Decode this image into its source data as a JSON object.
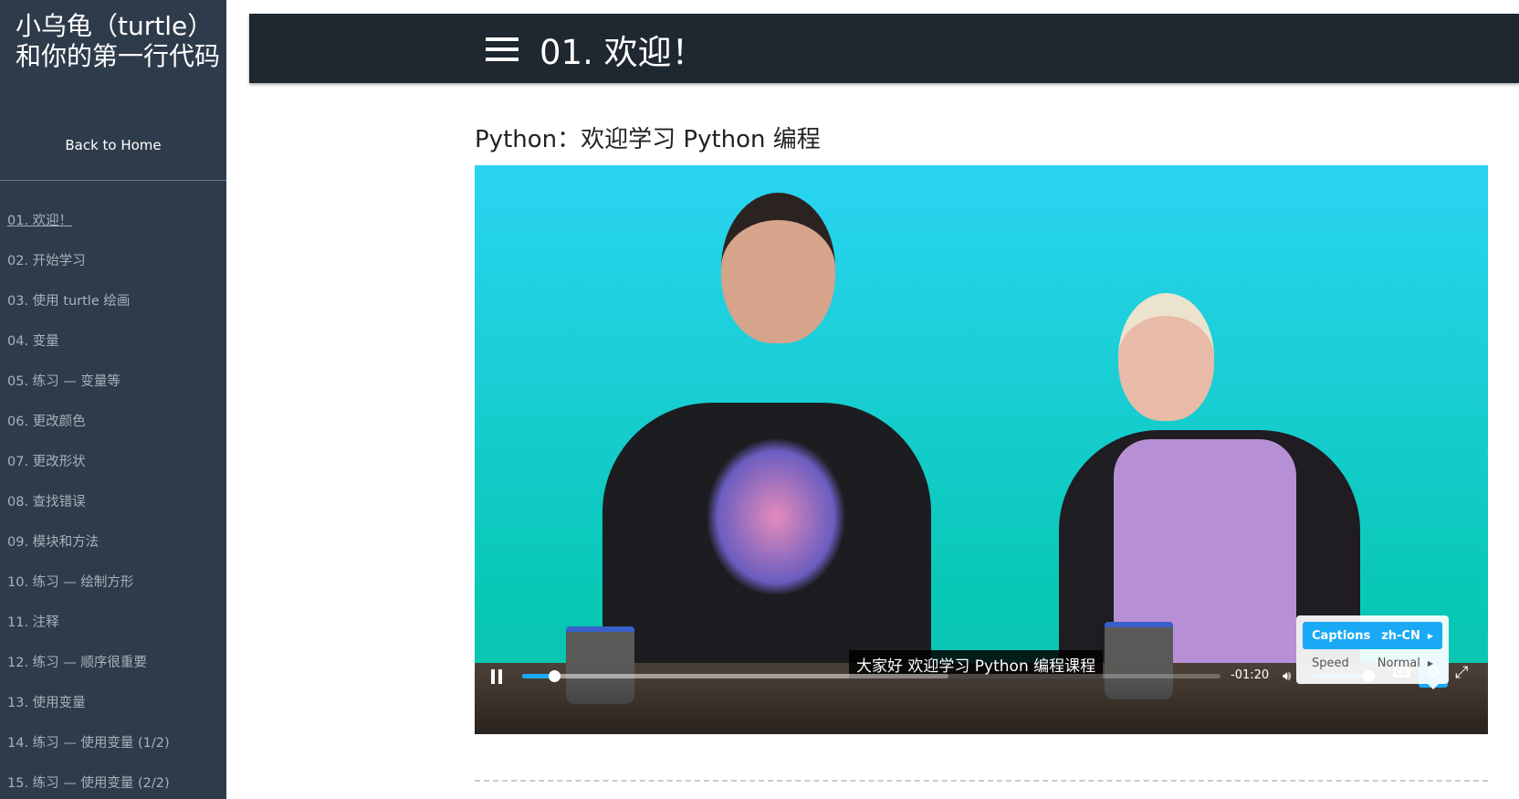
{
  "sidebar": {
    "title": "小乌龟（turtle）和你的第一行代码",
    "back": "Back to Home",
    "items": [
      "01. 欢迎！",
      "02. 开始学习",
      "03. 使用 turtle 绘画",
      "04. 变量",
      "05. 练习 — 变量等",
      "06. 更改颜色",
      "07. 更改形状",
      "08. 查找错误",
      "09. 模块和方法",
      "10. 练习 — 绘制方形",
      "11. 注释",
      "12. 练习 — 顺序很重要",
      "13. 使用变量",
      "14. 练习 — 使用变量 (1/2)",
      "15. 练习 — 使用变量 (2/2)"
    ]
  },
  "header": {
    "title": "01. 欢迎！"
  },
  "lesson": {
    "title": "Python：欢迎学习 Python 编程"
  },
  "video": {
    "caption": "大家好 欢迎学习 Python 编程课程",
    "time_remaining": "-01:20",
    "progress_percent": 4.6,
    "buffered_percent": 61,
    "volume_percent": 85,
    "cc_label": "CC",
    "settings": {
      "captions_label": "Captions",
      "captions_value": "zh-CN",
      "speed_label": "Speed",
      "speed_value": "Normal"
    }
  },
  "colors": {
    "accent": "#1aaaf5",
    "sidebar": "#2e3b4b",
    "header": "#1f2731"
  }
}
